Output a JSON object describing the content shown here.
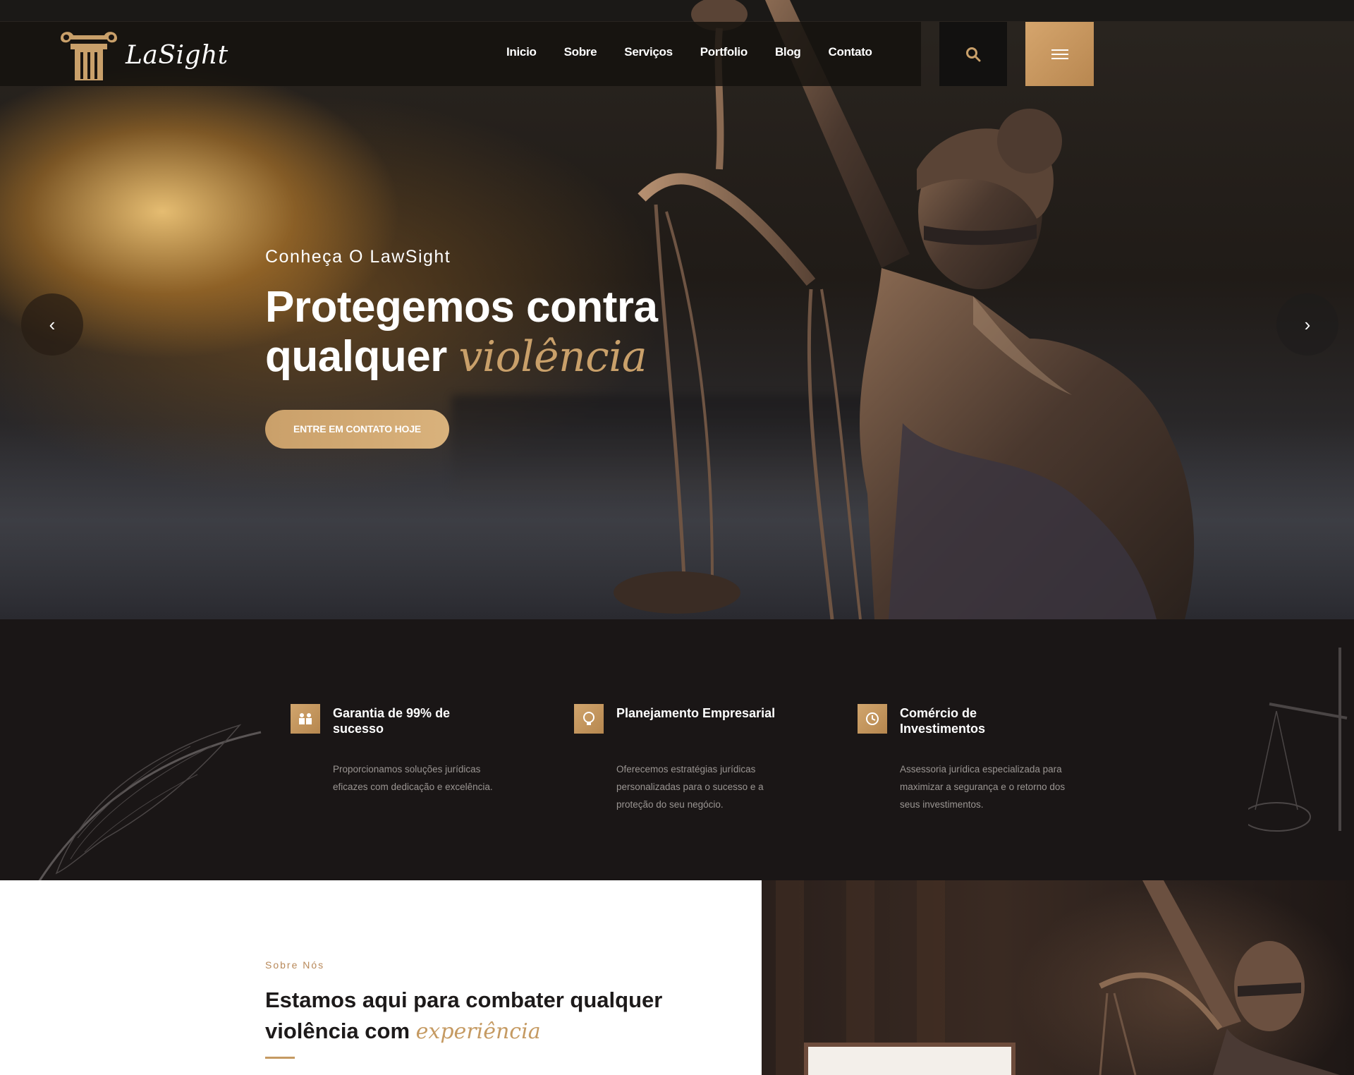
{
  "brand": {
    "name": "LaSight"
  },
  "nav": {
    "items": [
      "Inicio",
      "Sobre",
      "Serviços",
      "Portfolio",
      "Blog",
      "Contato"
    ]
  },
  "icons": {
    "logo": "column-icon",
    "search": "search-icon",
    "menu": "hamburger-menu-icon",
    "slider_prev": "chevron-left-icon",
    "slider_next": "chevron-right-icon"
  },
  "hero": {
    "kicker": "Conheça O LawSight",
    "title_line1": "Protegemos contra",
    "title_line2": "qualquer",
    "title_accent": "violência",
    "cta_label": "ENTRE EM CONTATO HOJE",
    "prev_arrow": "‹",
    "next_arrow": "›"
  },
  "features": [
    {
      "icon": "people-icon",
      "title": "Garantia de 99% de sucesso",
      "text": "Proporcionamos soluções jurídicas eficazes com dedicação e excelência."
    },
    {
      "icon": "bulb-icon",
      "title": "Planejamento Empresarial",
      "text": "Oferecemos estratégias jurídicas personalizadas para o sucesso e a proteção do seu negócio."
    },
    {
      "icon": "clock-icon",
      "title": "Comércio de Investimentos",
      "text": "Assessoria jurídica especializada para maximizar a segurança e o retorno dos seus investimentos."
    }
  ],
  "about": {
    "kicker": "Sobre Nós",
    "title_main": "Estamos aqui para combater qualquer violência com",
    "title_accent": "experiência"
  },
  "colors": {
    "gold": "#c9a06a",
    "dark": "#1a1616",
    "white": "#ffffff"
  }
}
